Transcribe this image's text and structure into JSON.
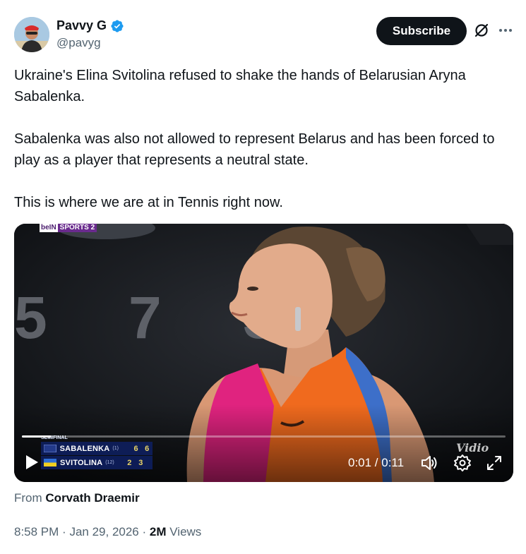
{
  "author": {
    "display_name": "Pavvy G",
    "handle": "@pavyg",
    "verified": true,
    "avatar_icon": "avatar"
  },
  "header": {
    "subscribe_label": "Subscribe",
    "grok_icon": "grok-icon",
    "more_icon": "more-dots-icon"
  },
  "tweet": {
    "paragraphs": [
      "Ukraine's Elina Svitolina refused to shake the hands of Belarusian Aryna Sabalenka.",
      "Sabalenka was also not allowed to represent Belarus and has been forced to play as a player that represents a neutral state.",
      "This is where we are at in Tennis right now."
    ]
  },
  "video": {
    "broadcaster_left": "beIN",
    "broadcaster_right": "SPORTS 2",
    "background_numbers": "5 7 3",
    "scoreboard": {
      "round": "SEMIFINAL",
      "players": [
        {
          "name": "SABALENKA",
          "seed": "(1)",
          "set1": "6",
          "set2": "6"
        },
        {
          "name": "SVITOLINA",
          "seed": "(12)",
          "set1": "2",
          "set2": "3"
        }
      ]
    },
    "watermark": "Vidio",
    "time_display": "0:01 / 0:11",
    "progress": 0.06,
    "colors": {
      "jersey_orange": "#f06a1e",
      "jersey_pink": "#e0237f",
      "scorebug_blue": "#0e1e5c"
    }
  },
  "attribution": {
    "prefix": "From",
    "source_name": "Corvath Draemir"
  },
  "meta": {
    "time": "8:58 PM",
    "separator": "·",
    "date": "Jan 29, 2026",
    "views_count": "2M",
    "views_label": "Views"
  }
}
